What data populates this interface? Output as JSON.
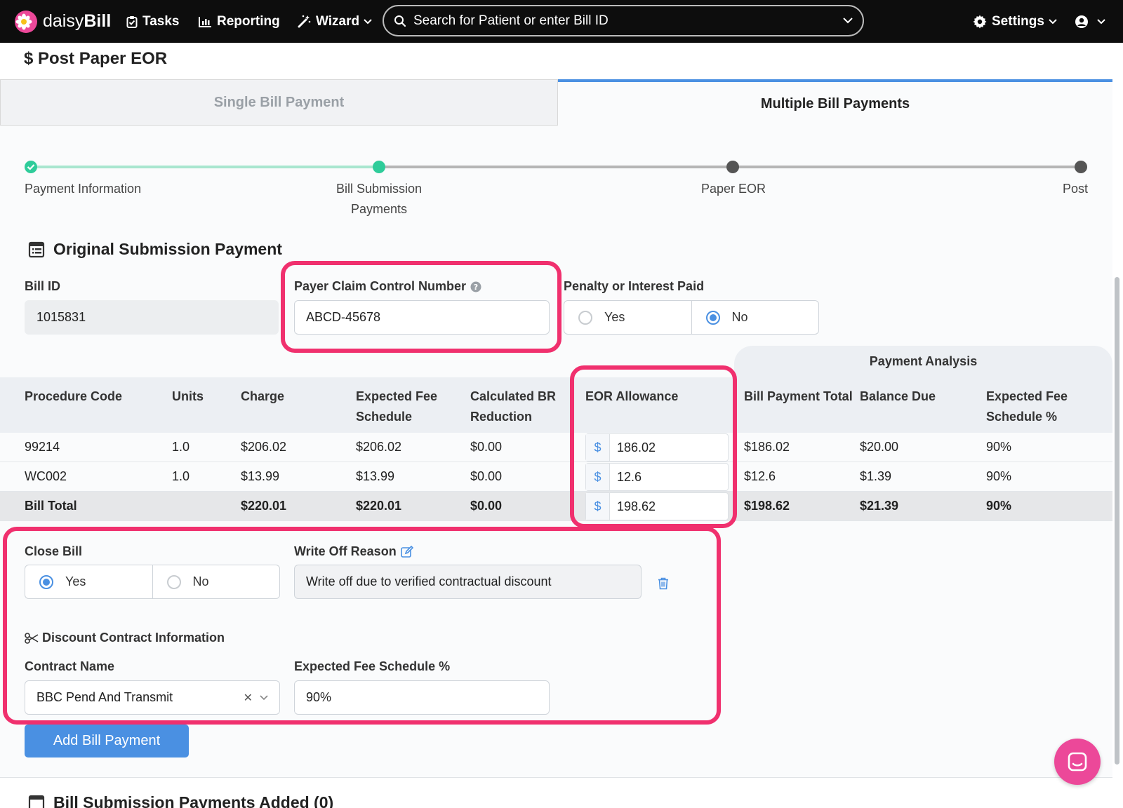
{
  "nav": {
    "logo_prefix": "daisy",
    "logo_suffix": "Bill",
    "tasks": "Tasks",
    "reporting": "Reporting",
    "wizard": "Wizard",
    "search_placeholder": "Search for Patient or enter Bill ID",
    "settings": "Settings"
  },
  "page": {
    "title": "Post Paper EOR",
    "tabs": [
      {
        "label": "Single Bill Payment",
        "active": false
      },
      {
        "label": "Multiple Bill Payments",
        "active": true
      }
    ]
  },
  "stepper": {
    "steps": [
      {
        "label": "Payment Information",
        "state": "complete"
      },
      {
        "label": "Bill Submission Payments",
        "state": "current"
      },
      {
        "label": "Paper EOR",
        "state": "pending"
      },
      {
        "label": "Post",
        "state": "pending"
      }
    ]
  },
  "form": {
    "section_title": "Original Submission Payment",
    "bill_id_label": "Bill ID",
    "bill_id_value": "1015831",
    "pccn_label": "Payer Claim Control Number",
    "pccn_value": "ABCD-45678",
    "penalty_label": "Penalty or Interest Paid",
    "penalty_yes": "Yes",
    "penalty_no": "No",
    "penalty_selected": "No"
  },
  "table": {
    "payment_analysis_label": "Payment Analysis",
    "headers": {
      "procedure_code": "Procedure Code",
      "units": "Units",
      "charge": "Charge",
      "expected_fee_1": "Expected Fee",
      "expected_fee_2": "Schedule",
      "calc_br_1": "Calculated BR",
      "calc_br_2": "Reduction",
      "eor_allowance": "EOR Allowance",
      "bill_payment_total": "Bill Payment Total",
      "balance_due": "Balance Due",
      "efs_pct_1": "Expected Fee",
      "efs_pct_2": "Schedule %"
    },
    "currency_symbol": "$",
    "rows": [
      {
        "code": "99214",
        "units": "1.0",
        "charge": "$206.02",
        "expected": "$206.02",
        "br": "$0.00",
        "allowance": "186.02",
        "payment_total": "$186.02",
        "balance": "$20.00",
        "pct": "90%"
      },
      {
        "code": "WC002",
        "units": "1.0",
        "charge": "$13.99",
        "expected": "$13.99",
        "br": "$0.00",
        "allowance": "12.6",
        "payment_total": "$12.6",
        "balance": "$1.39",
        "pct": "90%"
      }
    ],
    "total": {
      "code": "Bill Total",
      "charge": "$220.01",
      "expected": "$220.01",
      "br": "$0.00",
      "allowance": "198.62",
      "payment_total": "$198.62",
      "balance": "$21.39",
      "pct": "90%"
    }
  },
  "close": {
    "close_bill_label": "Close Bill",
    "yes": "Yes",
    "no": "No",
    "selected": "Yes",
    "write_off_label": "Write Off Reason",
    "write_off_value": "Write off due to verified contractual discount",
    "discount_title": "Discount Contract Information",
    "contract_name_label": "Contract Name",
    "contract_name_value": "BBC Pend And Transmit",
    "efs_label": "Expected Fee Schedule %",
    "efs_value": "90%"
  },
  "actions": {
    "add_bill_payment": "Add Bill Payment"
  },
  "added": {
    "title": "Bill Submission Payments Added (0)"
  },
  "colors": {
    "accent": "#4a90e2",
    "highlight": "#f0306e",
    "step_complete": "#2ecc9a",
    "brand_pink": "#ec4899"
  }
}
